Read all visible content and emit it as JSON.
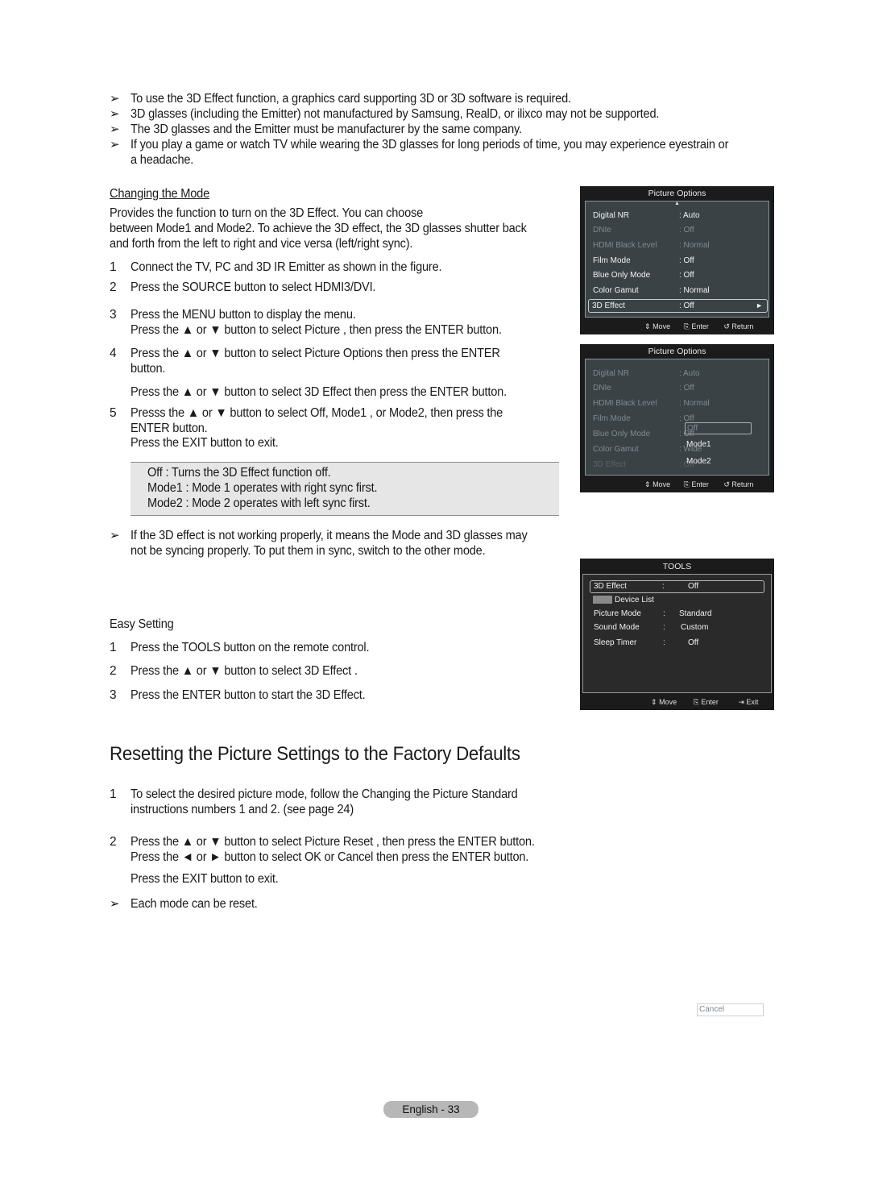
{
  "notes_top": [
    "To use the 3D Effect function, a graphics card supporting 3D or 3D software is required.",
    "3D glasses (including the Emitter) not manufactured by Samsung, RealD, or ilixco may not be supported.",
    "The 3D glasses and the Emitter must be manufacturer by the same company.",
    "If you play a game or watch TV while wearing the 3D glasses for long periods of time, you may experience eyestrain or",
    "a headache."
  ],
  "bullet_glyph": "➢",
  "changing_mode": {
    "title": "Changing the Mode",
    "intro": [
      "Provides the function to turn on the 3D Effect. You can choose",
      "between Mode1 and Mode2. To achieve the 3D effect, the 3D glasses shutter back",
      "and forth from the left to right and vice versa (left/right sync)."
    ],
    "steps": [
      {
        "num": "1",
        "lines": [
          "Connect the TV, PC and 3D IR Emitter as shown in the figure."
        ]
      },
      {
        "num": "2",
        "lines": [
          "Press the SOURCE button to select HDMI3/DVI."
        ]
      },
      {
        "num": "3",
        "lines": [
          "Press the MENU button to display the menu.",
          "Press the ▲ or ▼ button to select Picture , then press the ENTER button."
        ]
      },
      {
        "num": "4",
        "lines": [
          "Press the ▲ or ▼ button to select Picture Options   then press the ENTER",
          "button.",
          "Press the ▲ or ▼ button to select 3D Effect  then press the ENTER button."
        ]
      },
      {
        "num": "5",
        "lines": [
          "Presss the ▲ or ▼ button to select Off, Mode1 , or Mode2, then press the",
          "ENTER button.",
          "Press the EXIT button to exit."
        ]
      }
    ],
    "mode_notes": [
      "Off : Turns the 3D Effect function off.",
      "Mode1 : Mode 1 operates with right sync first.",
      "Mode2 : Mode 2 operates with left sync first."
    ],
    "tip": [
      "If the 3D effect is not working properly, it means the Mode and 3D glasses may",
      "not be syncing properly. To put them in sync, switch to the other mode."
    ]
  },
  "easy_setting": {
    "title": "Easy Setting",
    "steps": [
      {
        "num": "1",
        "text": "Press the TOOLS button on the remote control."
      },
      {
        "num": "2",
        "text": "Press the ▲ or ▼ button to select 3D Effect ."
      },
      {
        "num": "3",
        "text": "Press the ENTER button to start the 3D Effect."
      }
    ]
  },
  "reset_section": {
    "title": "Resetting the Picture Settings to the Factory Defaults",
    "steps": [
      {
        "num": "1",
        "lines": [
          "To select the desired picture mode, follow the Changing the Picture Standard",
          "instructions numbers 1 and 2. (see page 24)"
        ]
      },
      {
        "num": "2",
        "lines": [
          "Press the ▲ or ▼ button to select Picture Reset  , then press the ENTER button.",
          "Press the ◄ or ► button to select OK or Cancel  then press the ENTER button.",
          "Press the EXIT button to exit."
        ]
      }
    ],
    "tip": "Each mode can be reset."
  },
  "osd1": {
    "title": "Picture Options",
    "scroll_up": "▲",
    "rows": [
      {
        "label": "Digital NR",
        "value": ": Auto",
        "state": "enabled"
      },
      {
        "label": "DNIe",
        "value": ": Off",
        "state": "disabled"
      },
      {
        "label": "HDMI Black Level",
        "value": ": Normal",
        "state": "disabled"
      },
      {
        "label": "Film Mode",
        "value": ": Off",
        "state": "enabled"
      },
      {
        "label": "Blue Only Mode",
        "value": ": Off",
        "state": "enabled"
      },
      {
        "label": "Color Gamut",
        "value": ": Normal",
        "state": "enabled"
      },
      {
        "label": "3D Effect",
        "value": ": Off",
        "state": "selected"
      }
    ],
    "arrow": "►",
    "footer": {
      "move": "Move",
      "enter": "Enter",
      "return": "Return"
    }
  },
  "osd2": {
    "title": "Picture Options",
    "rows": [
      {
        "label": "Digital NR",
        "value": ": Auto"
      },
      {
        "label": "DNIe",
        "value": ": Off"
      },
      {
        "label": "HDMI Black Level",
        "value": ": Normal"
      },
      {
        "label": "Film Mode",
        "value": ": Off"
      },
      {
        "label": "Blue Only Mode",
        "value": ": Off"
      },
      {
        "label": "Color Gamut",
        "value": ": Wide"
      },
      {
        "label": "3D Effect",
        "value": ": Off"
      }
    ],
    "dropdown": {
      "options": [
        "Off",
        "Mode1",
        "Mode2"
      ],
      "selected": "Off"
    },
    "footer": {
      "move": "Move",
      "enter": "Enter",
      "return": "Return"
    }
  },
  "osd3": {
    "title": "TOOLS",
    "rows": [
      {
        "label": "3D Effect",
        "sep": ":",
        "value": "Off",
        "selected": true
      },
      {
        "label": "Device List",
        "sep": "",
        "value": "",
        "icon": "anynet-icon"
      },
      {
        "label": "Picture Mode",
        "sep": ":",
        "value": "Standard"
      },
      {
        "label": "Sound Mode",
        "sep": ":",
        "value": "Custom"
      },
      {
        "label": "Sleep Timer",
        "sep": ":",
        "value": "Off"
      }
    ],
    "footer": {
      "move": "Move",
      "enter": "Enter",
      "exit": "Exit"
    }
  },
  "cancel_fragment": "Cancel",
  "page_footer": "English - 33"
}
